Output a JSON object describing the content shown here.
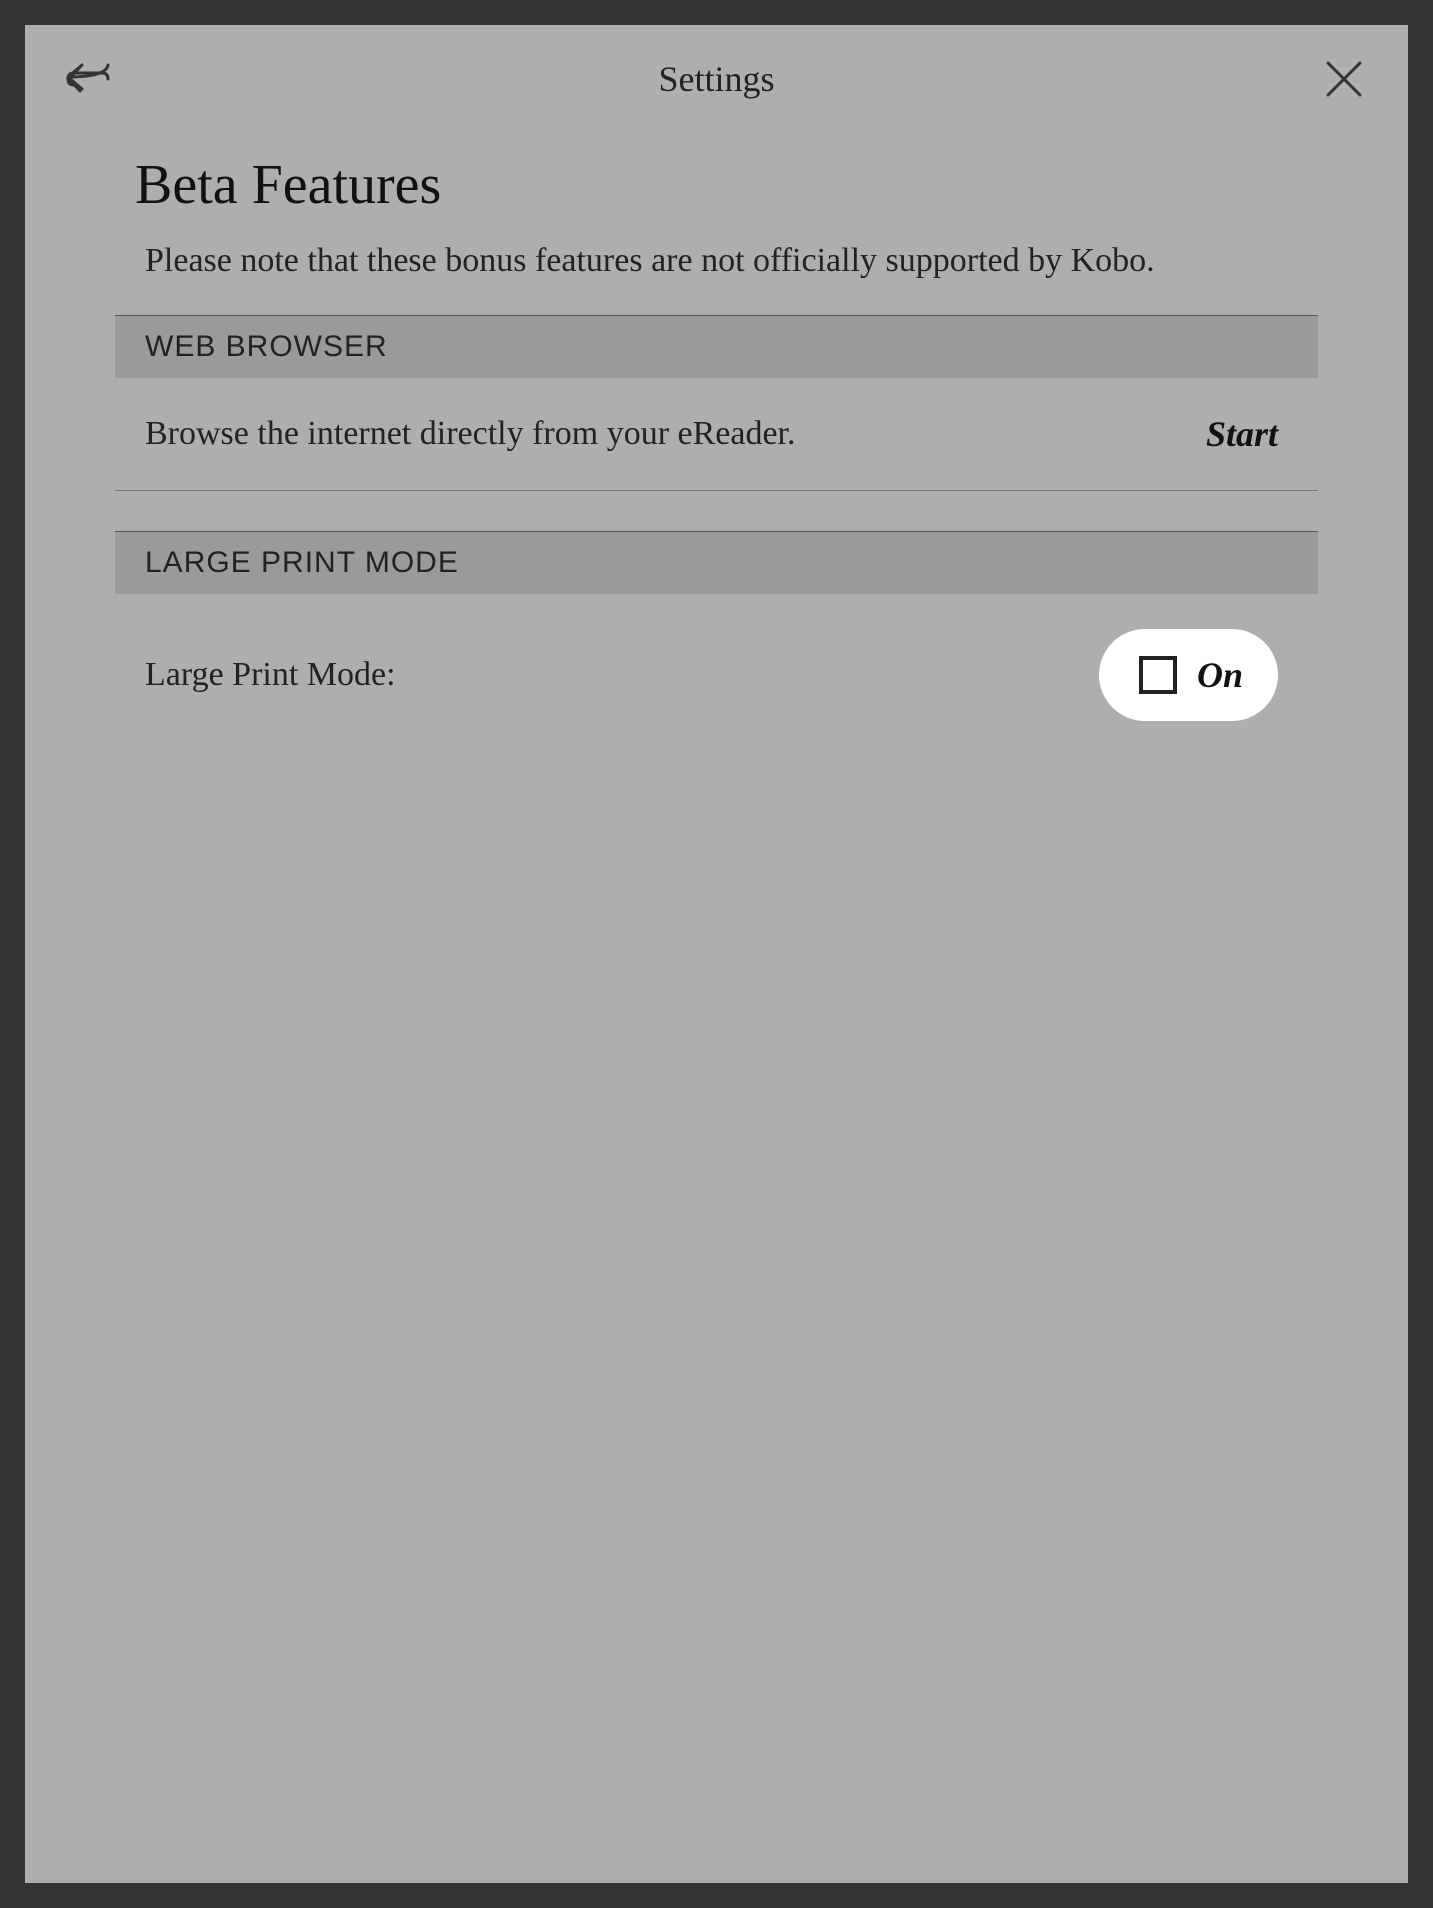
{
  "header": {
    "title": "Settings"
  },
  "page": {
    "title": "Beta Features",
    "subtitle": "Please note that these bonus features are not officially supported by Kobo."
  },
  "sections": {
    "webBrowser": {
      "header": "WEB BROWSER",
      "description": "Browse the internet directly from your eReader.",
      "action": "Start"
    },
    "largePrint": {
      "header": "LARGE PRINT MODE",
      "label": "Large Print Mode:",
      "toggleLabel": "On",
      "checked": false
    }
  }
}
